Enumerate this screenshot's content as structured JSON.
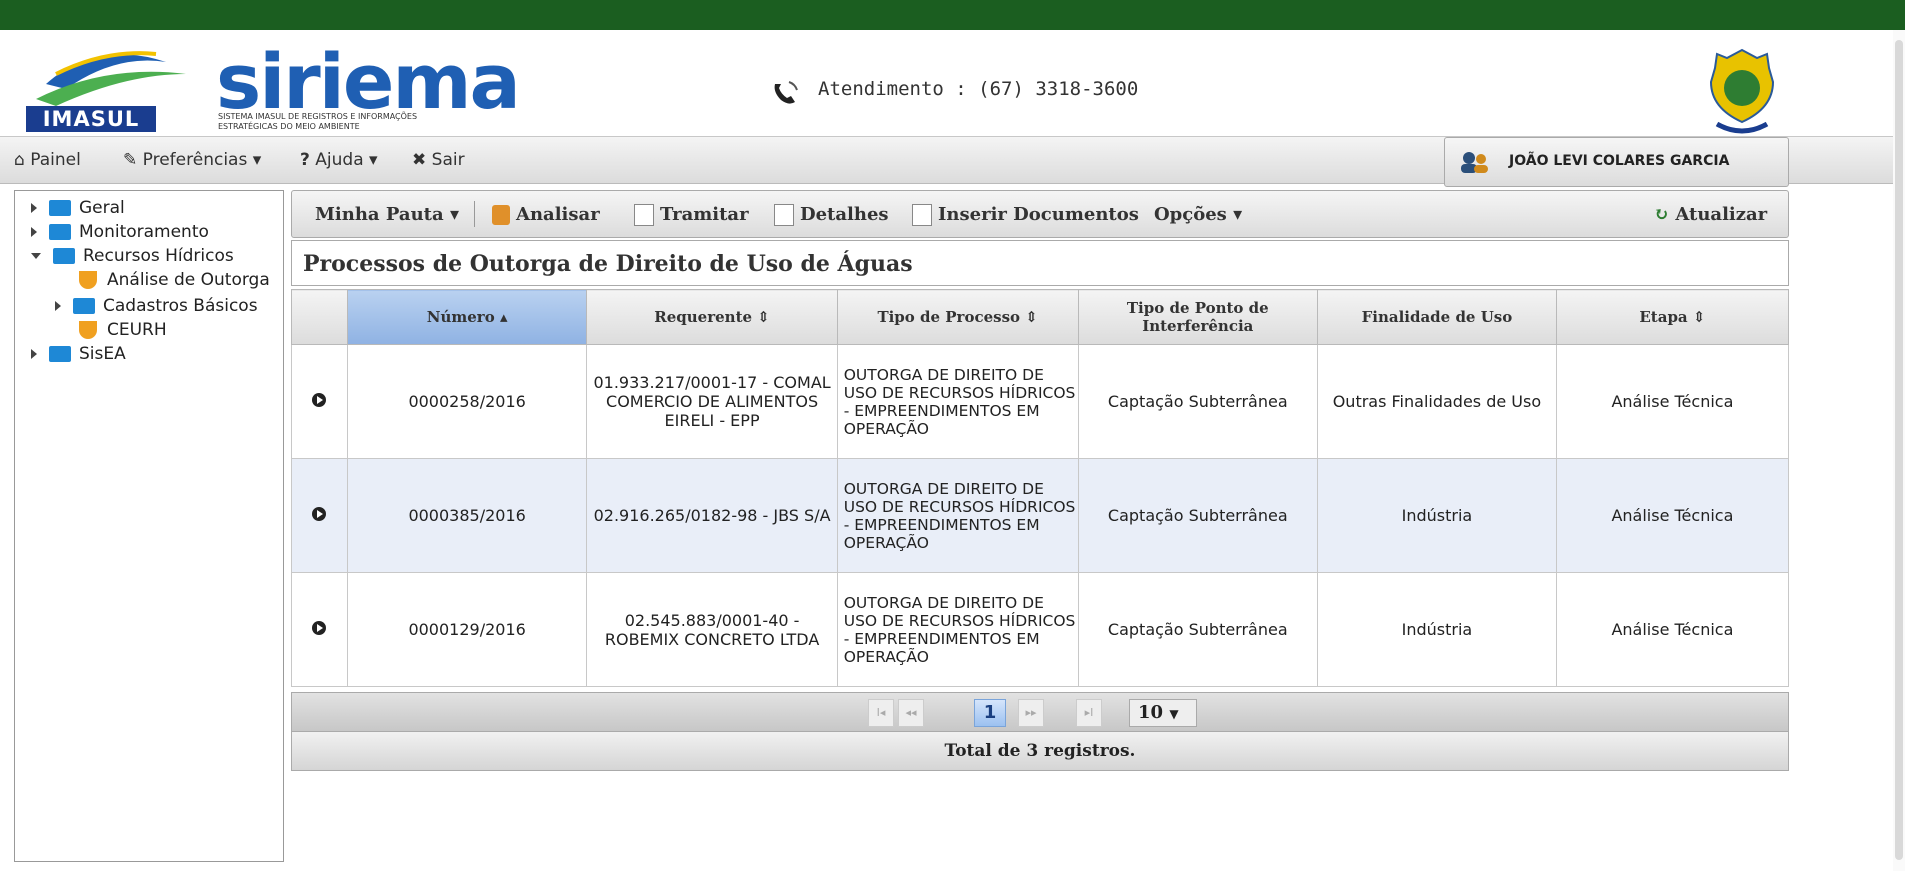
{
  "header": {
    "logo_text": "siriema",
    "logo_sub": "SISTEMA IMASUL DE REGISTROS E INFORMAÇÕES ESTRATÉGICAS DO MEIO AMBIENTE",
    "imasul": "IMASUL",
    "atendimento": "Atendimento : (67) 3318-3600"
  },
  "menu": {
    "painel": "Painel",
    "preferencias": "Preferências",
    "ajuda": "Ajuda",
    "sair": "Sair",
    "user": "JOÃO LEVI COLARES GARCIA"
  },
  "sidebar": {
    "items": [
      {
        "label": "Geral"
      },
      {
        "label": "Monitoramento"
      },
      {
        "label": "Recursos Hídricos"
      },
      {
        "label": "Análise de Outorga"
      },
      {
        "label": "Cadastros Básicos"
      },
      {
        "label": "CEURH"
      },
      {
        "label": "SisEA"
      }
    ]
  },
  "toolbar": {
    "minha_pauta": "Minha Pauta",
    "analisar": "Analisar",
    "tramitar": "Tramitar",
    "detalhes": "Detalhes",
    "inserir": "Inserir Documentos",
    "opcoes": "Opções",
    "atualizar": "Atualizar"
  },
  "page_title": "Processos de Outorga de Direito de Uso de Águas",
  "table": {
    "columns": [
      "Número",
      "Requerente",
      "Tipo de Processo",
      "Tipo de Ponto de Interferência",
      "Finalidade de Uso",
      "Etapa"
    ],
    "rows": [
      {
        "numero": "0000258/2016",
        "requerente": "01.933.217/0001-17 - COMAL COMERCIO DE ALIMENTOS EIRELI - EPP",
        "tipo": "OUTORGA DE DIREITO DE USO DE RECURSOS HÍDRICOS - EMPREENDIMENTOS EM OPERAÇÃO",
        "ponto": "Captação Subterrânea",
        "finalidade": "Outras Finalidades de Uso",
        "etapa": "Análise Técnica"
      },
      {
        "numero": "0000385/2016",
        "requerente": "02.916.265/0182-98 - JBS S/A",
        "tipo": "OUTORGA DE DIREITO DE USO DE RECURSOS HÍDRICOS - EMPREENDIMENTOS EM OPERAÇÃO",
        "ponto": "Captação Subterrânea",
        "finalidade": "Indústria",
        "etapa": "Análise Técnica"
      },
      {
        "numero": "0000129/2016",
        "requerente": "02.545.883/0001-40 - ROBEMIX CONCRETO LTDA",
        "tipo": "OUTORGA DE DIREITO DE USO DE RECURSOS HÍDRICOS - EMPREENDIMENTOS EM OPERAÇÃO",
        "ponto": "Captação Subterrânea",
        "finalidade": "Indústria",
        "etapa": "Análise Técnica"
      }
    ]
  },
  "pager": {
    "current": "1",
    "first": "I◂",
    "prev": "◂◂",
    "next": "▸▸",
    "last": "▸I",
    "rows_per_page": "10"
  },
  "total": "Total de 3 registros.",
  "colors": {
    "topbar": "#1b5e20",
    "accent": "#1f5fb3",
    "sorted_header": "#9fbfea",
    "row_alt": "#e9eef8"
  },
  "icons": [
    "home-icon",
    "wrench-icon",
    "help-icon",
    "close-icon",
    "users-icon",
    "phone-icon",
    "folder-icon",
    "shield-icon",
    "refresh-icon"
  ]
}
